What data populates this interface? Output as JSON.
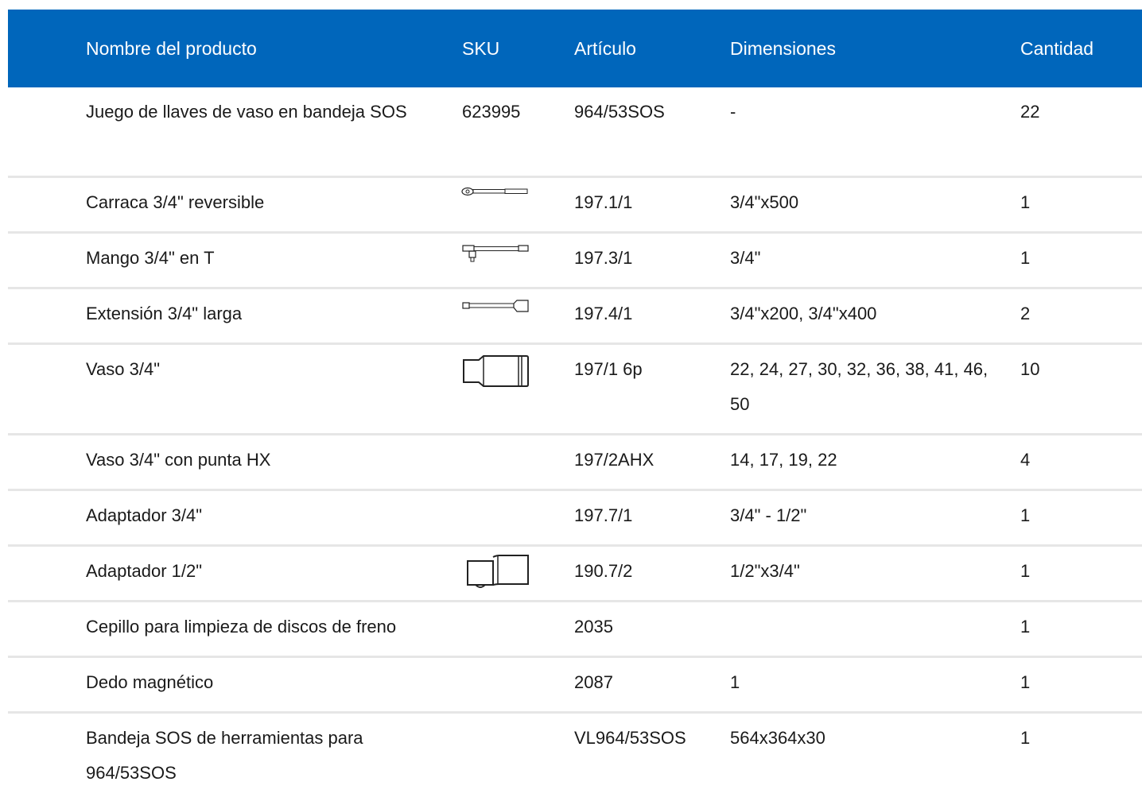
{
  "header": {
    "name": "Nombre del producto",
    "sku": "SKU",
    "article": "Artículo",
    "dimensions": "Dimensiones",
    "quantity": "Cantidad"
  },
  "rows": [
    {
      "name": "Juego de llaves de vaso en bandeja SOS",
      "sku": "623995",
      "article": "964/53SOS",
      "dimensions": "-",
      "quantity": "22"
    },
    {
      "name": "Carraca 3/4\" reversible",
      "sku": "",
      "icon": "ratchet-icon",
      "article": "197.1/1",
      "dimensions": "3/4\"x500",
      "quantity": "1"
    },
    {
      "name": "Mango 3/4\" en T",
      "sku": "",
      "icon": "t-handle-icon",
      "article": "197.3/1",
      "dimensions": "3/4\"",
      "quantity": "1"
    },
    {
      "name": "Extensión 3/4\" larga",
      "sku": "",
      "icon": "extension-bar-icon",
      "article": "197.4/1",
      "dimensions": "3/4\"x200, 3/4\"x400",
      "quantity": "2"
    },
    {
      "name": "Vaso 3/4\"",
      "sku": "",
      "icon": "socket-icon",
      "article": "197/1 6p",
      "dimensions": "22, 24, 27, 30, 32, 36, 38, 41, 46, 50",
      "quantity": "10"
    },
    {
      "name": "Vaso 3/4\" con punta HX",
      "sku": "",
      "article": "197/2AHX",
      "dimensions": "14, 17, 19, 22",
      "quantity": "4"
    },
    {
      "name": "Adaptador 3/4\"",
      "sku": "",
      "article": "197.7/1",
      "dimensions": "3/4\" - 1/2\"",
      "quantity": "1"
    },
    {
      "name": "Adaptador 1/2\"",
      "sku": "",
      "icon": "adapter-icon",
      "article": "190.7/2",
      "dimensions": "1/2\"x3/4\"",
      "quantity": "1"
    },
    {
      "name": "Cepillo para limpieza de discos de freno",
      "sku": "",
      "article": "2035",
      "dimensions": "",
      "quantity": "1"
    },
    {
      "name": "Dedo magnético",
      "sku": "",
      "article": "2087",
      "dimensions": "1",
      "quantity": "1"
    },
    {
      "name": "Bandeja SOS de herramientas para 964/53SOS",
      "sku": "",
      "article": "VL964/53SOS",
      "dimensions": "564x364x30",
      "quantity": "1"
    }
  ]
}
